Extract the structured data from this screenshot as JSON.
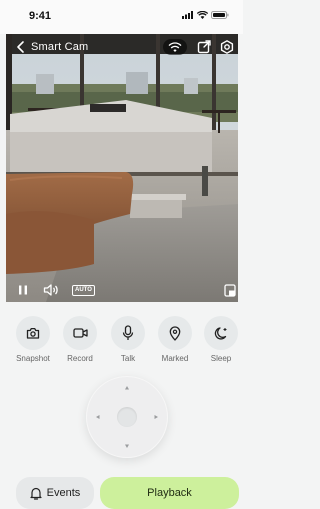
{
  "status_bar": {
    "time": "9:41"
  },
  "header": {
    "title": "Smart Cam"
  },
  "player": {
    "quality_badge": "AUTO"
  },
  "actions": [
    {
      "label": "Snapshot",
      "icon": "camera-icon"
    },
    {
      "label": "Record",
      "icon": "video-icon"
    },
    {
      "label": "Talk",
      "icon": "microphone-icon"
    },
    {
      "label": "Marked",
      "icon": "location-pin-icon"
    },
    {
      "label": "Sleep",
      "icon": "moon-icon"
    }
  ],
  "footer": {
    "events_label": "Events",
    "playback_label": "Playback"
  },
  "colors": {
    "accent": "#cdf09c",
    "background": "#f3f4f4"
  }
}
